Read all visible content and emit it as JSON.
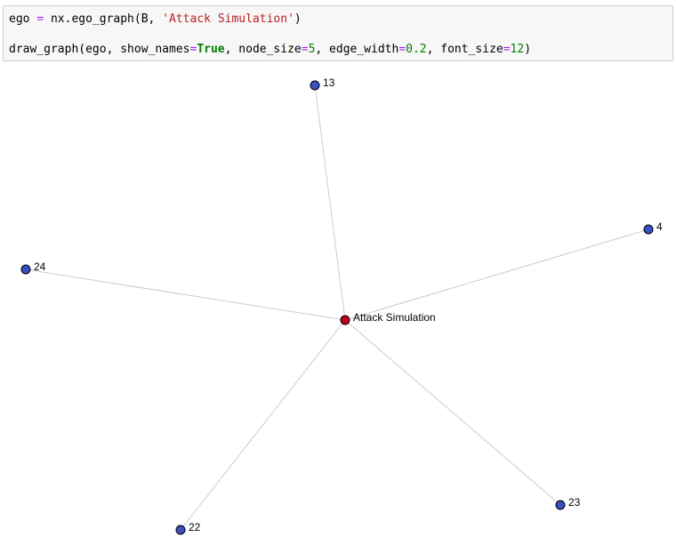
{
  "code_cell": {
    "line1": [
      {
        "t": "ego ",
        "c": ""
      },
      {
        "t": "=",
        "c": "op"
      },
      {
        "t": " nx.ego_graph(B, ",
        "c": ""
      },
      {
        "t": "'Attack Simulation'",
        "c": "str"
      },
      {
        "t": ")",
        "c": ""
      }
    ],
    "line2": [
      {
        "t": "draw_graph(ego, show_names",
        "c": ""
      },
      {
        "t": "=",
        "c": "op"
      },
      {
        "t": "True",
        "c": "kw"
      },
      {
        "t": ", node_size",
        "c": ""
      },
      {
        "t": "=",
        "c": "op"
      },
      {
        "t": "5",
        "c": "num"
      },
      {
        "t": ", edge_width",
        "c": ""
      },
      {
        "t": "=",
        "c": "op"
      },
      {
        "t": "0.2",
        "c": "num"
      },
      {
        "t": ", font_size",
        "c": ""
      },
      {
        "t": "=",
        "c": "op"
      },
      {
        "t": "12",
        "c": "num"
      },
      {
        "t": ")",
        "c": ""
      }
    ]
  },
  "graph": {
    "center": "Attack Simulation",
    "neighbors": [
      "13",
      "4",
      "24",
      "22",
      "23"
    ],
    "colors": {
      "center_node": "#c0001a",
      "neighbor_node": "#3a4fc0",
      "node_border": "#000000",
      "edge": "#cccccc"
    }
  }
}
